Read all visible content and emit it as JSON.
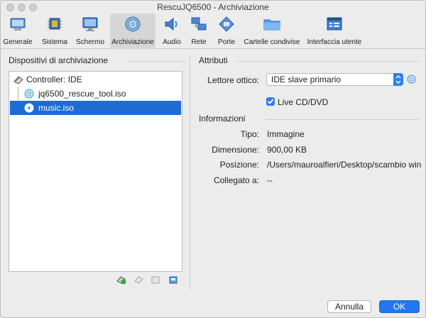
{
  "window": {
    "title": "RescuJQ6500 - Archiviazione"
  },
  "toolbar": {
    "items": [
      {
        "label": "Generale",
        "icon": "general-icon",
        "active": false
      },
      {
        "label": "Sistema",
        "icon": "system-chip-icon",
        "active": false
      },
      {
        "label": "Schermo",
        "icon": "display-icon",
        "active": false
      },
      {
        "label": "Archiviazione",
        "icon": "storage-disk-icon",
        "active": true
      },
      {
        "label": "Audio",
        "icon": "speaker-icon",
        "active": false
      },
      {
        "label": "Rete",
        "icon": "network-icon",
        "active": false
      },
      {
        "label": "Porte",
        "icon": "ports-icon",
        "active": false
      },
      {
        "label": "Cartelle condivise",
        "icon": "folder-icon",
        "active": false
      },
      {
        "label": "Interfaccia utente",
        "icon": "user-interface-icon",
        "active": false
      }
    ]
  },
  "storage": {
    "heading": "Dispositivi di archiviazione",
    "controller": "Controller: IDE",
    "items": [
      {
        "label": "jq6500_rescue_tool.iso",
        "selected": false
      },
      {
        "label": "music.iso",
        "selected": true
      }
    ]
  },
  "attributes": {
    "heading": "Attributi",
    "optical_label": "Lettore ottico:",
    "optical_value": "IDE slave primario",
    "live_label": "Live CD/DVD",
    "live_checked": true
  },
  "info": {
    "heading": "Informazioni",
    "rows": [
      {
        "label": "Tipo:",
        "value": "Immagine"
      },
      {
        "label": "Dimensione:",
        "value": "900,00 KB"
      },
      {
        "label": "Posizione:",
        "value": "/Users/mauroalfieri/Desktop/scambio win..."
      },
      {
        "label": "Collegato a:",
        "value": "--"
      }
    ]
  },
  "buttons": {
    "cancel": "Annulla",
    "ok": "OK"
  },
  "colors": {
    "accent": "#1e6bd6",
    "selection": "#1e6bd6"
  }
}
